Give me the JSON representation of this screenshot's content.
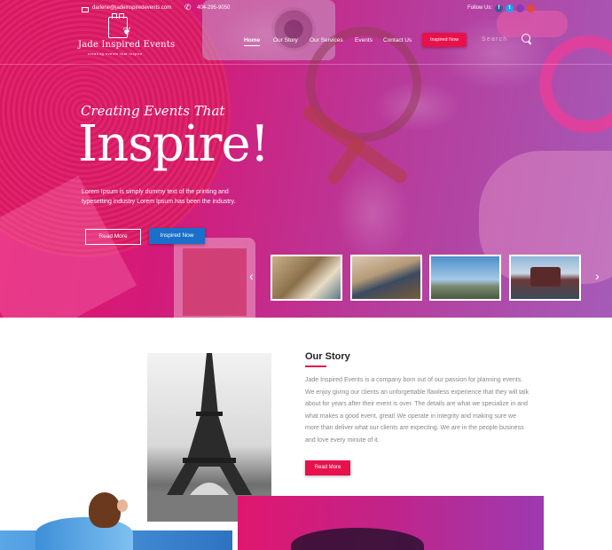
{
  "topbar": {
    "email": "darlene@jadeinspiredevents.com",
    "phone": "404-295-9050",
    "follow_label": "Follow Us:",
    "social": [
      "f",
      "t",
      "in",
      "g+"
    ]
  },
  "logo": {
    "name": "Jade Inspired Events",
    "tagline": "creating events that inspire"
  },
  "nav": {
    "items": [
      "Home",
      "Our Story",
      "Our Services",
      "Events",
      "Contact Us"
    ],
    "cta": "Inspired Now",
    "search_placeholder": "Search"
  },
  "hero": {
    "script": "Creating Events That",
    "headline": "Inspire!",
    "description": "Lorem Ipsum is simply dummy text of the printing and typesetting industry Lorem Ipsum has been the industry.",
    "read_more": "Read More",
    "inspired_now": "Inspired Now"
  },
  "story": {
    "title": "Our Story",
    "body": "Jade Inspired Events is a company born out of our passion for planning events. We enjoy giving our clients an unforgettable flawless experience that they will talk about for years after their event is over. The details are what we specialize in and what makes a good event, great! We operate in integrity and making sure we more than deliver what our clients are expecting. We are in the people business and love every minute of it.",
    "button": "Read More"
  },
  "colors": {
    "accent": "#e8114c",
    "blue_button": "#1a6fc9"
  }
}
